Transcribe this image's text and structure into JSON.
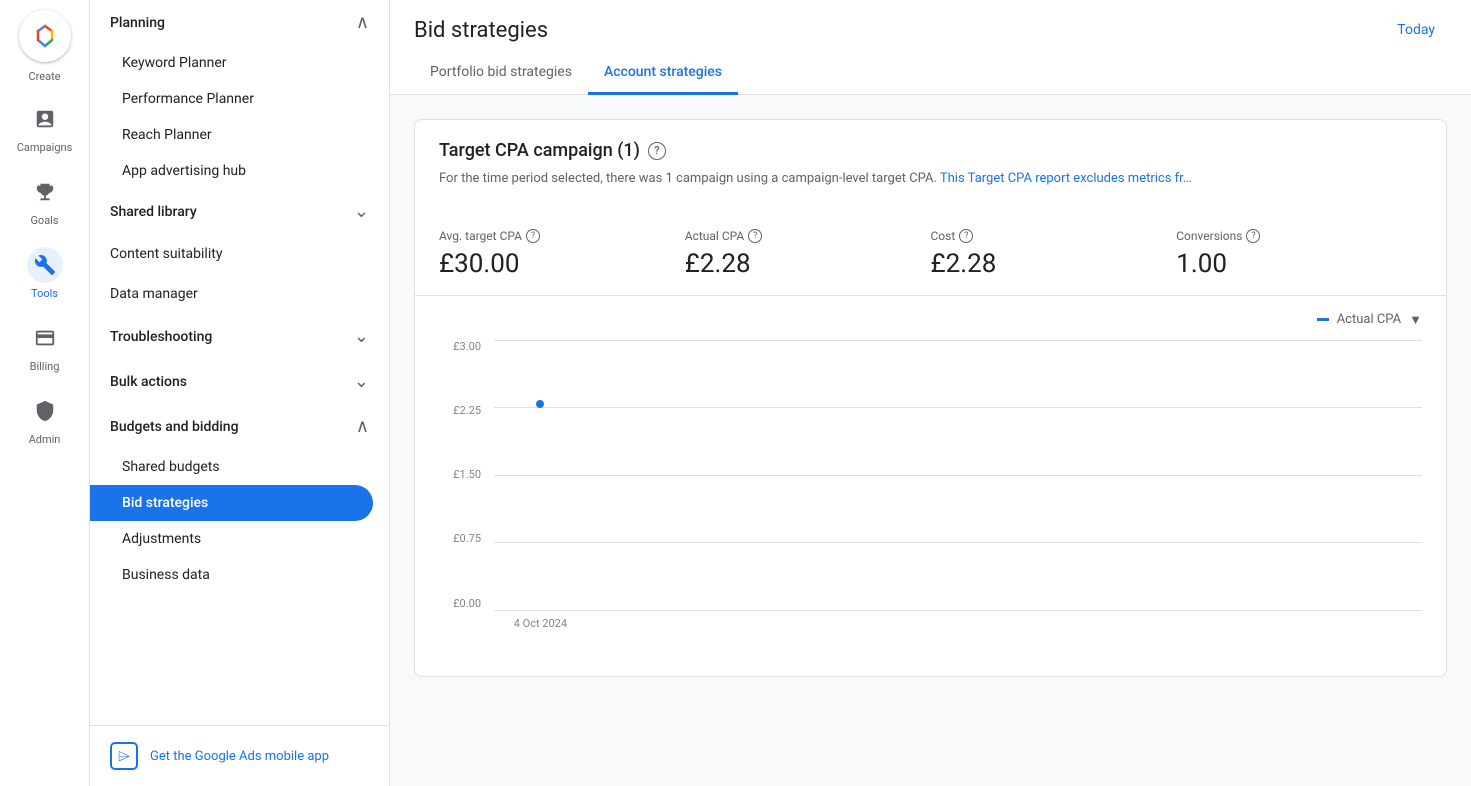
{
  "iconBar": {
    "create_label": "Create",
    "campaigns_label": "Campaigns",
    "goals_label": "Goals",
    "tools_label": "Tools",
    "billing_label": "Billing",
    "admin_label": "Admin"
  },
  "sidebar": {
    "planning_label": "Planning",
    "keyword_planner_label": "Keyword Planner",
    "performance_planner_label": "Performance Planner",
    "reach_planner_label": "Reach Planner",
    "app_advertising_label": "App advertising hub",
    "shared_library_label": "Shared library",
    "content_suitability_label": "Content suitability",
    "data_manager_label": "Data manager",
    "troubleshooting_label": "Troubleshooting",
    "bulk_actions_label": "Bulk actions",
    "budgets_bidding_label": "Budgets and bidding",
    "shared_budgets_label": "Shared budgets",
    "bid_strategies_label": "Bid strategies",
    "adjustments_label": "Adjustments",
    "business_data_label": "Business data",
    "mobile_app_label": "Get the Google Ads mobile app"
  },
  "header": {
    "title": "Bid strategies",
    "today_label": "Today",
    "tabs": [
      {
        "label": "Portfolio bid strategies",
        "active": false
      },
      {
        "label": "Account strategies",
        "active": true
      }
    ]
  },
  "content": {
    "card_title": "Target CPA campaign (1)",
    "card_subtitle": "For the time period selected, there was 1 campaign using a campaign-level target CPA.",
    "card_subtitle_link": "This Target CPA report excludes metrics fr…",
    "metrics": [
      {
        "label": "Avg. target CPA",
        "value": "£30.00"
      },
      {
        "label": "Actual CPA",
        "value": "£2.28"
      },
      {
        "label": "Cost",
        "value": "£2.28"
      },
      {
        "label": "Conversions",
        "value": "1.00"
      }
    ],
    "chart": {
      "legend_label": "Actual CPA",
      "y_labels": [
        "£3.00",
        "£2.25",
        "£1.50",
        "£0.75",
        "£0.00"
      ],
      "x_label": "4 Oct 2024",
      "data_point": {
        "x_pct": 8,
        "y_pct": 25
      }
    }
  }
}
